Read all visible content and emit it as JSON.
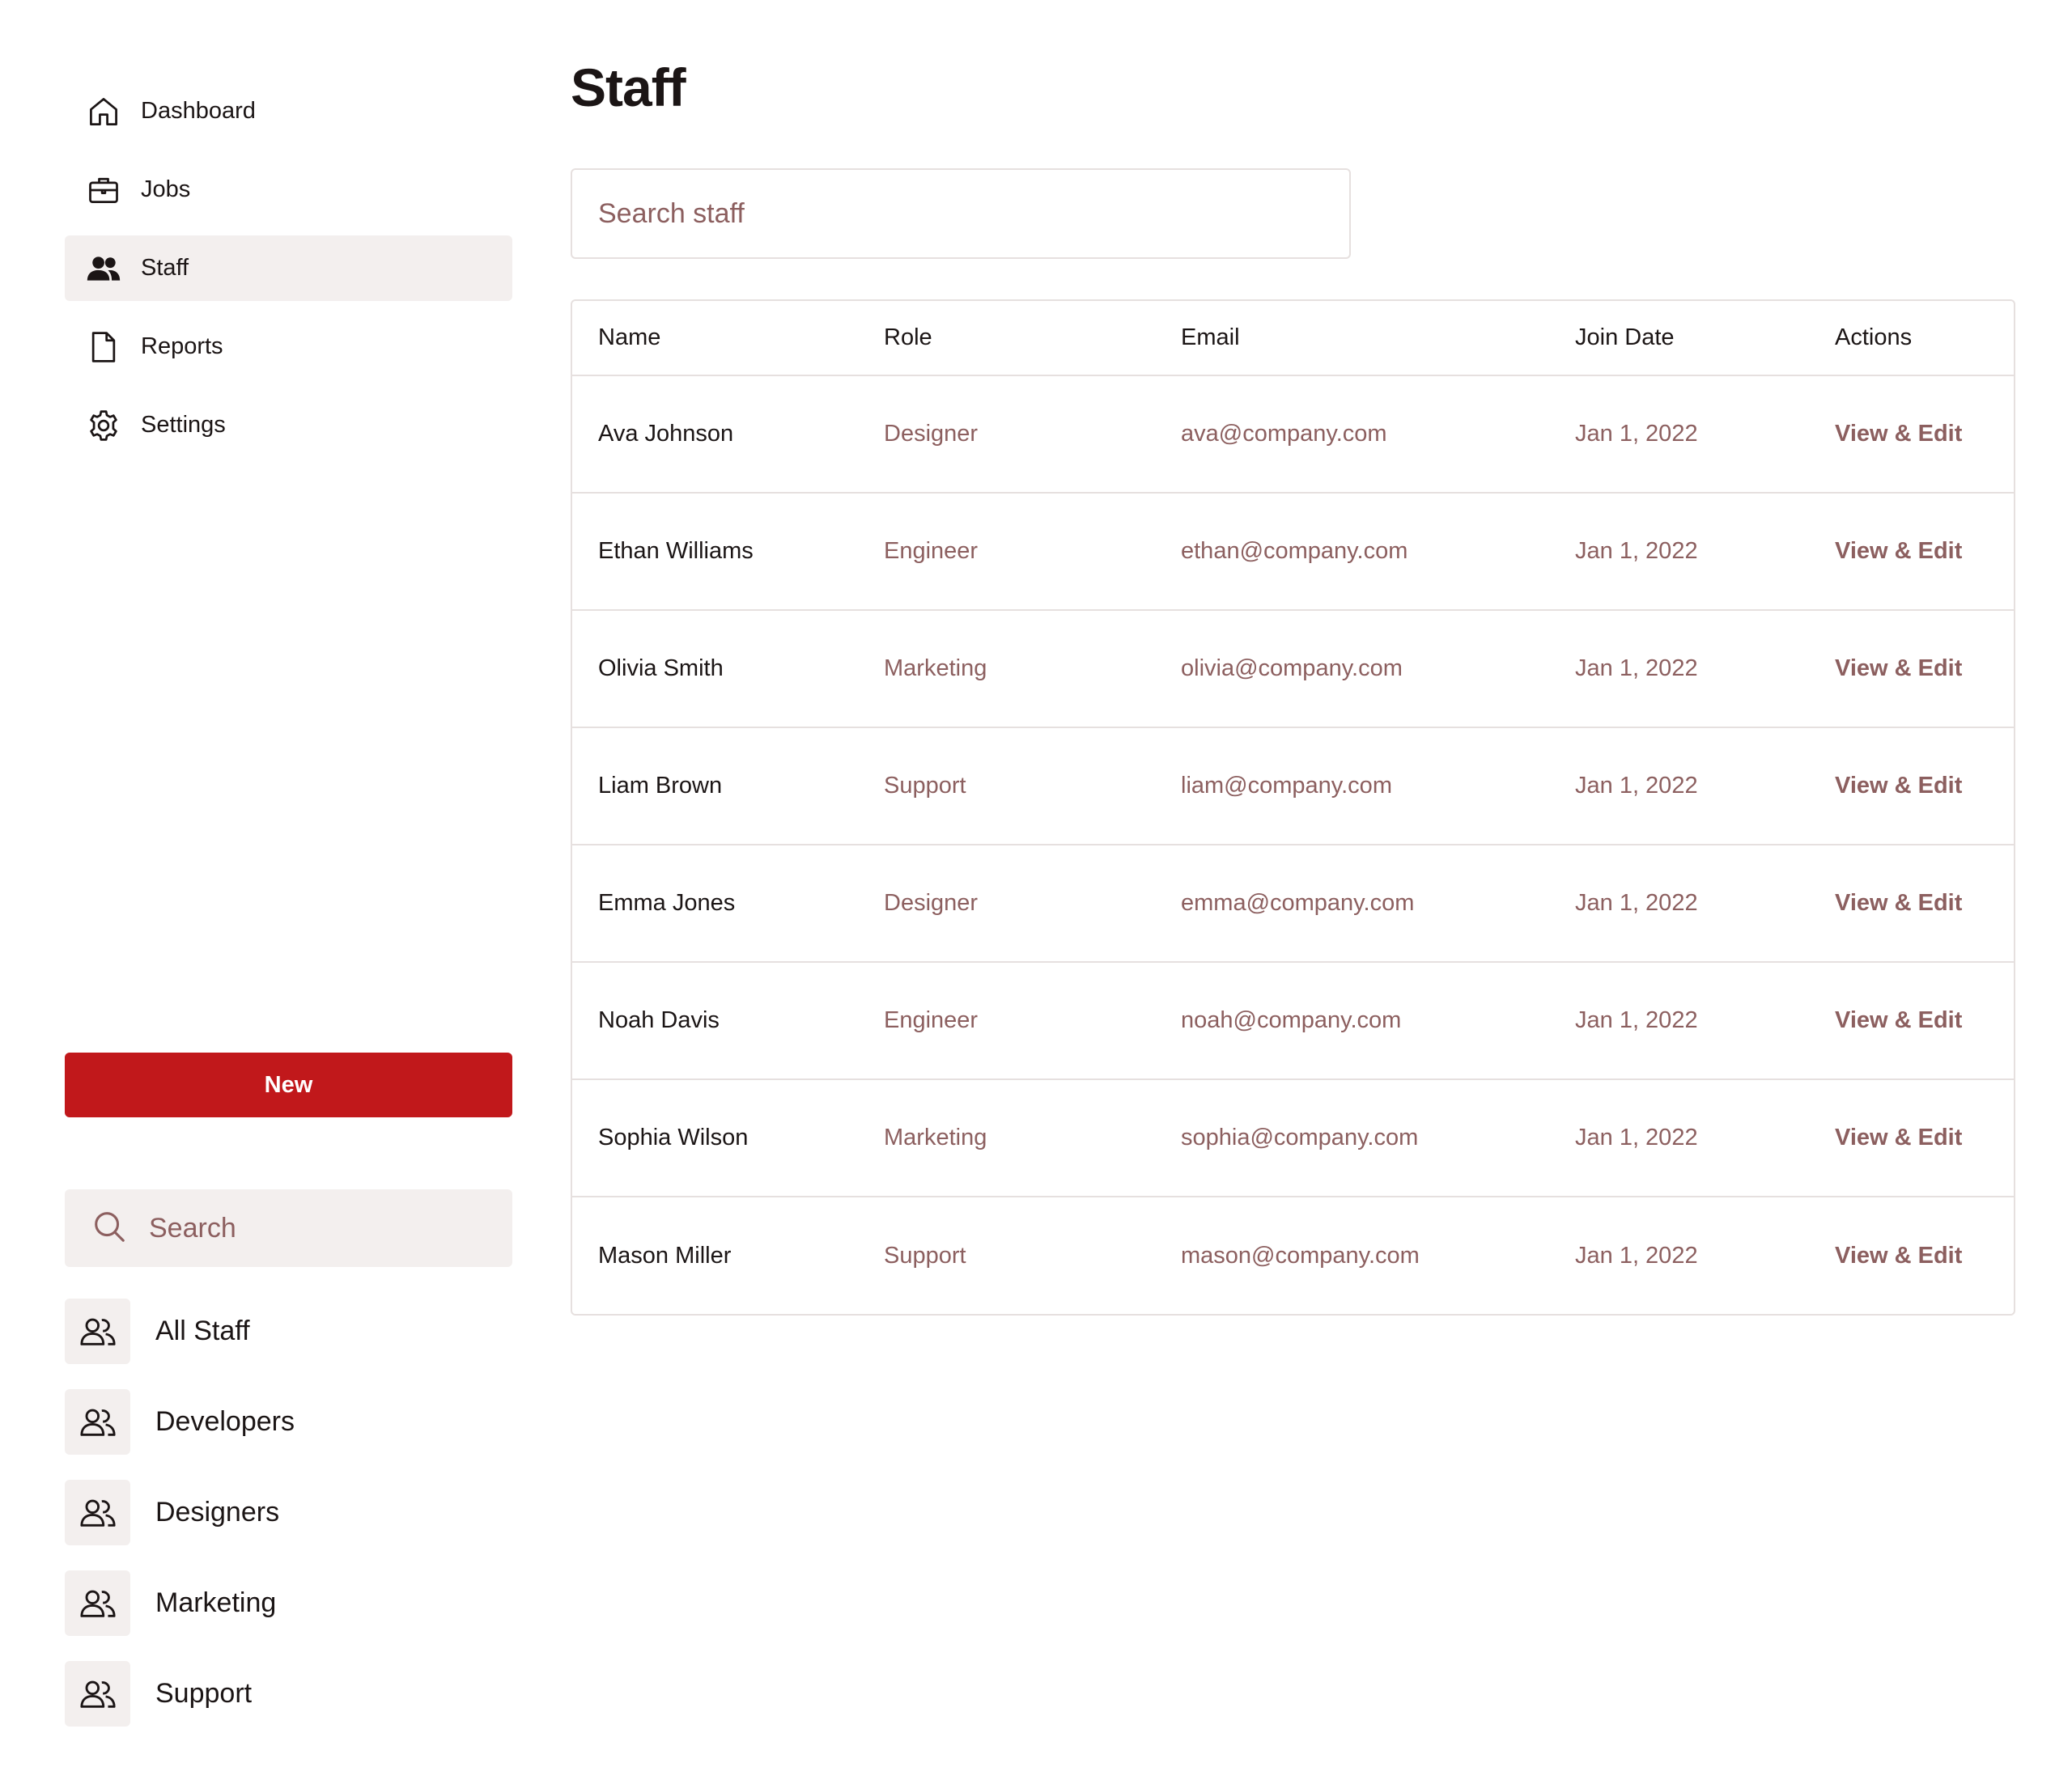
{
  "nav": {
    "items": [
      {
        "label": "Dashboard",
        "icon": "home-icon",
        "active": false
      },
      {
        "label": "Jobs",
        "icon": "briefcase-icon",
        "active": false
      },
      {
        "label": "Staff",
        "icon": "users-icon",
        "active": true
      },
      {
        "label": "Reports",
        "icon": "document-icon",
        "active": false
      },
      {
        "label": "Settings",
        "icon": "gear-icon",
        "active": false
      }
    ]
  },
  "sidebar": {
    "new_button_label": "New",
    "search_placeholder": "Search",
    "groups": [
      {
        "label": "All Staff",
        "icon": "users-outline-icon"
      },
      {
        "label": "Developers",
        "icon": "users-outline-icon"
      },
      {
        "label": "Designers",
        "icon": "users-outline-icon"
      },
      {
        "label": "Marketing",
        "icon": "users-outline-icon"
      },
      {
        "label": "Support",
        "icon": "users-outline-icon"
      }
    ]
  },
  "main": {
    "title": "Staff",
    "search_placeholder": "Search staff",
    "table": {
      "headers": {
        "name": "Name",
        "role": "Role",
        "email": "Email",
        "join_date": "Join Date",
        "actions": "Actions"
      },
      "rows": [
        {
          "name": "Ava Johnson",
          "role": "Designer",
          "email": "ava@company.com",
          "join_date": "Jan 1, 2022",
          "action": "View & Edit"
        },
        {
          "name": "Ethan Williams",
          "role": "Engineer",
          "email": "ethan@company.com",
          "join_date": "Jan 1, 2022",
          "action": "View & Edit"
        },
        {
          "name": "Olivia Smith",
          "role": "Marketing",
          "email": "olivia@company.com",
          "join_date": "Jan 1, 2022",
          "action": "View & Edit"
        },
        {
          "name": "Liam Brown",
          "role": "Support",
          "email": "liam@company.com",
          "join_date": "Jan 1, 2022",
          "action": "View & Edit"
        },
        {
          "name": "Emma Jones",
          "role": "Designer",
          "email": "emma@company.com",
          "join_date": "Jan 1, 2022",
          "action": "View & Edit"
        },
        {
          "name": "Noah Davis",
          "role": "Engineer",
          "email": "noah@company.com",
          "join_date": "Jan 1, 2022",
          "action": "View & Edit"
        },
        {
          "name": "Sophia Wilson",
          "role": "Marketing",
          "email": "sophia@company.com",
          "join_date": "Jan 1, 2022",
          "action": "View & Edit"
        },
        {
          "name": "Mason Miller",
          "role": "Support",
          "email": "mason@company.com",
          "join_date": "Jan 1, 2022",
          "action": "View & Edit"
        }
      ]
    }
  },
  "colors": {
    "accent": "#c1181b",
    "muted_text": "#8c5f5f",
    "active_bg": "#f3efee",
    "border": "#e6e0df",
    "text": "#1b1515"
  }
}
